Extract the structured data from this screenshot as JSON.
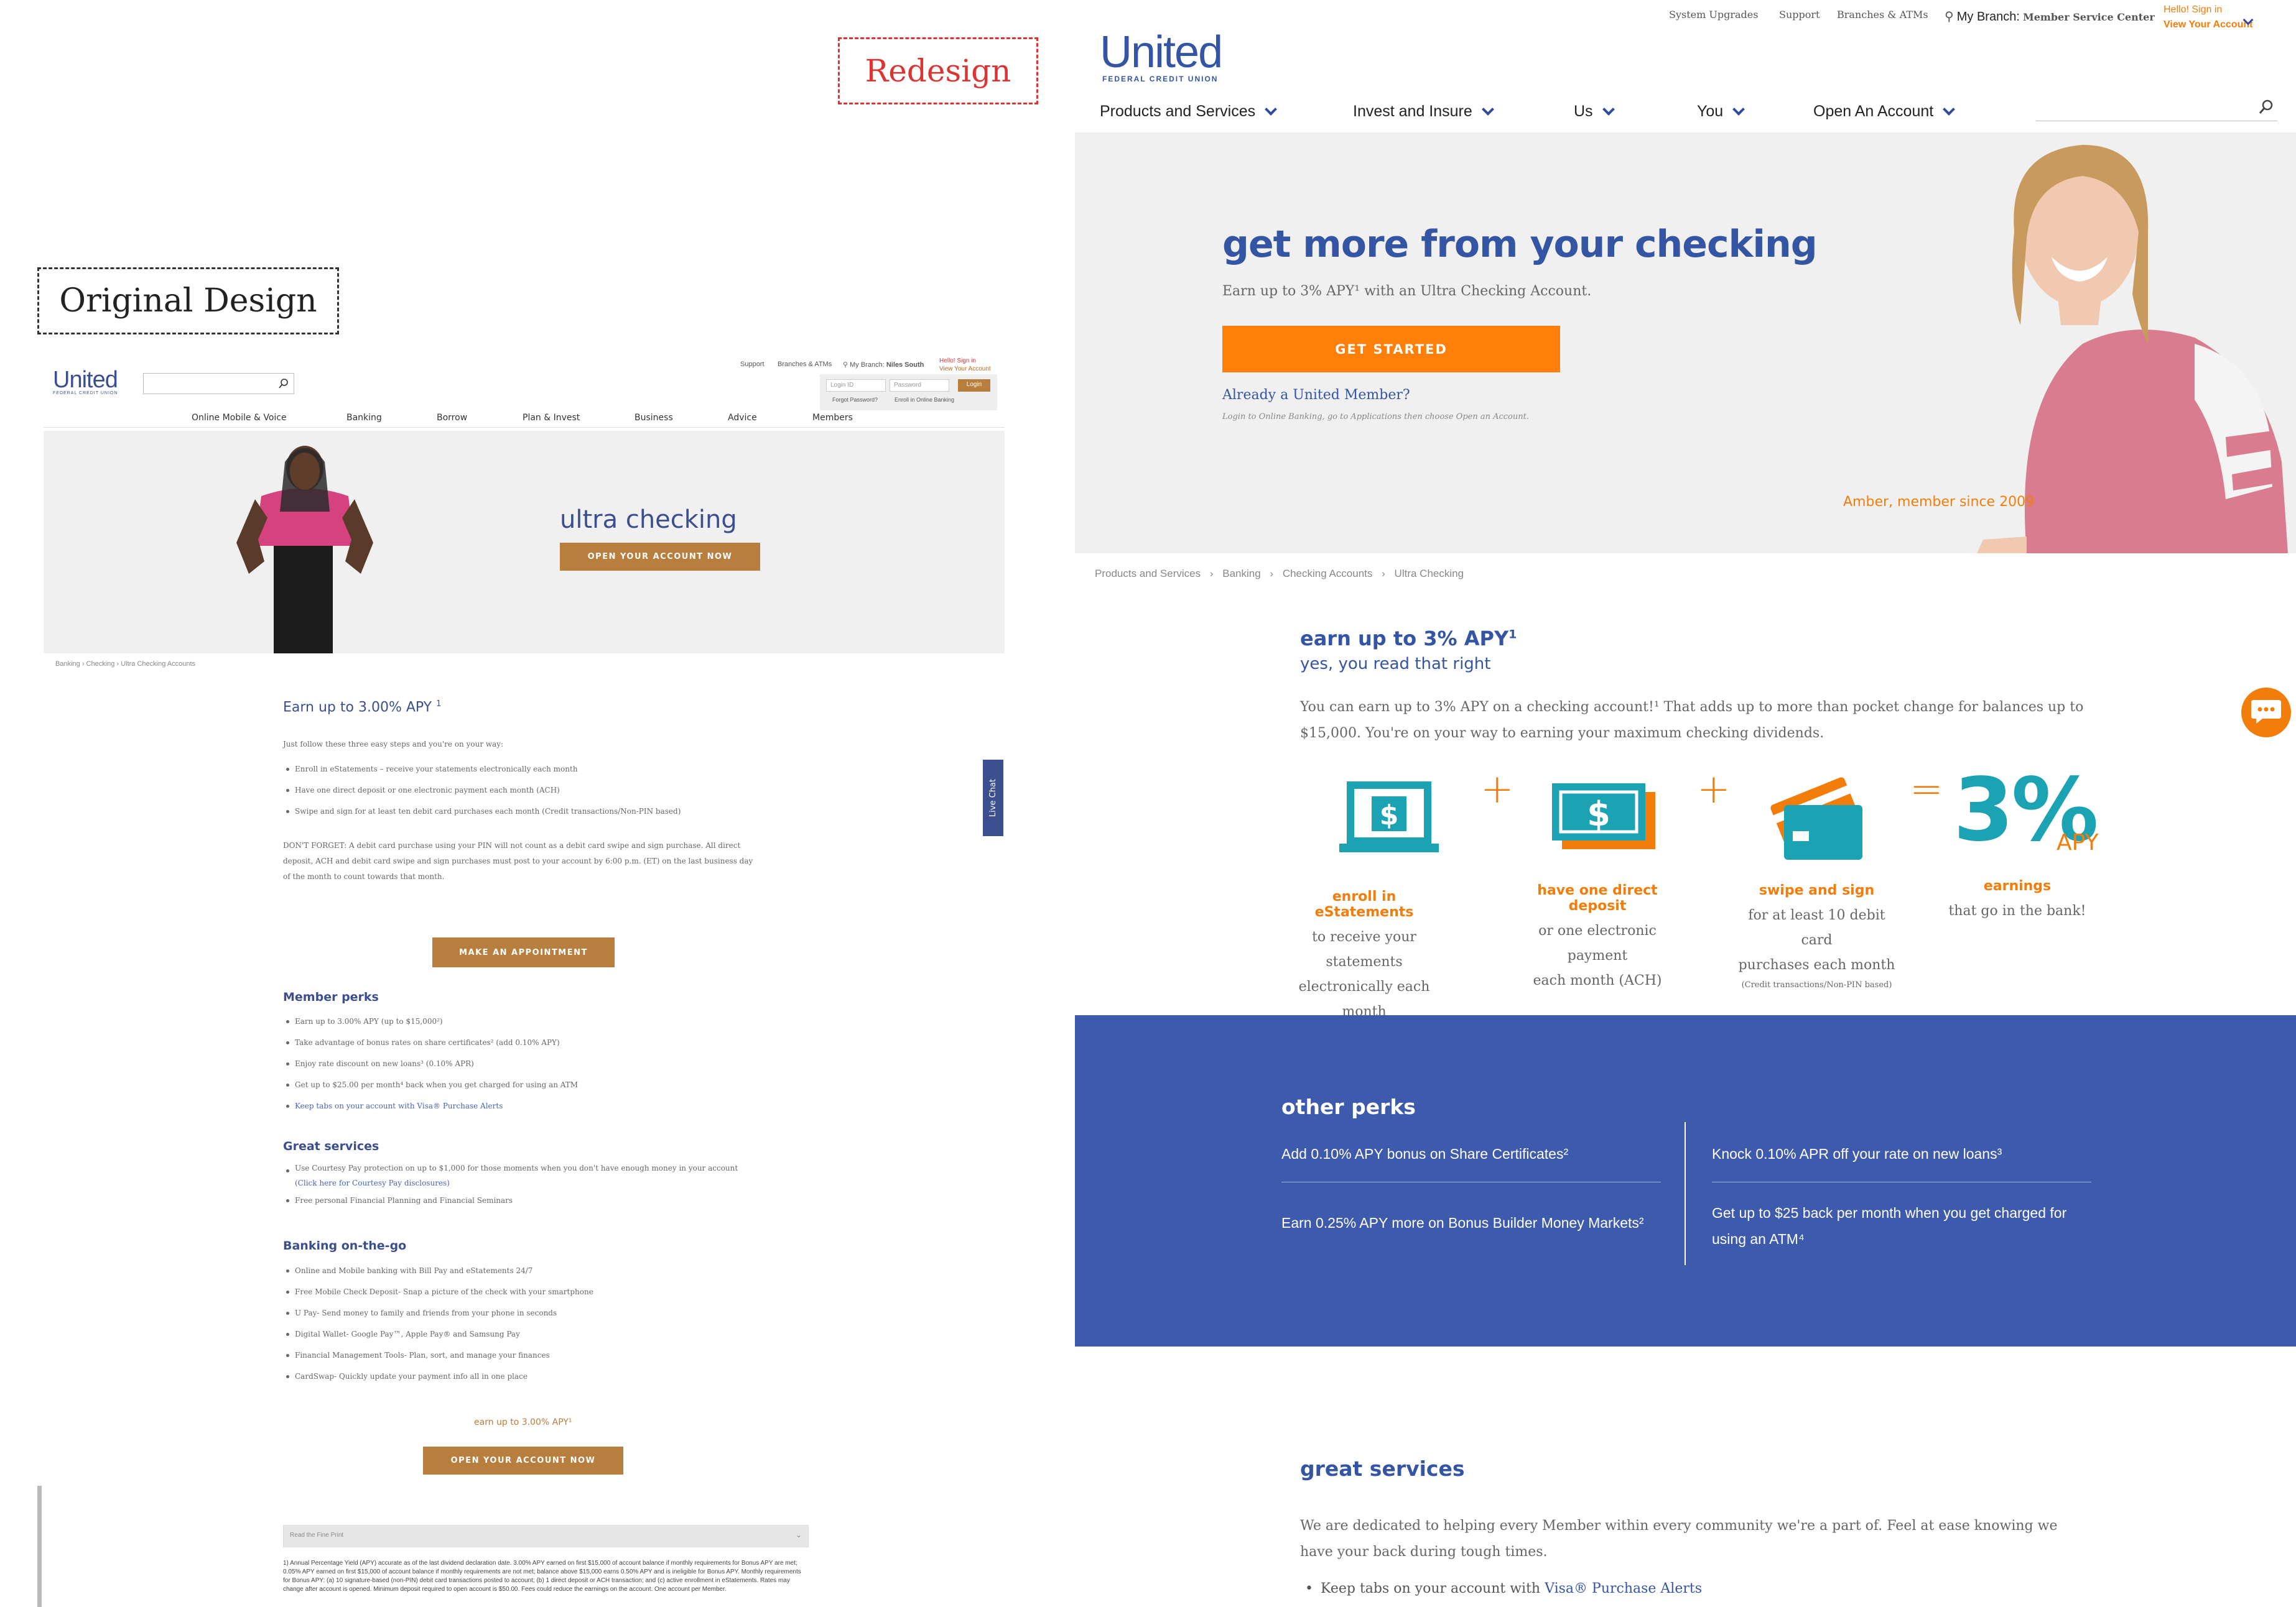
{
  "labels": {
    "redesign": "Redesign",
    "original": "Original Design"
  },
  "original": {
    "logo": {
      "name": "United",
      "sub": "FEDERAL CREDIT UNION"
    },
    "top_links": [
      "Support",
      "Branches & ATMs"
    ],
    "branch_label": "My Branch:",
    "branch_name": "Niles South",
    "hello": "Hello! Sign in",
    "view_account": "View Your Account",
    "login_placeholder": "Login ID",
    "password_placeholder": "Password",
    "login_btn": "Login",
    "forgot": "Forgot Password?",
    "enroll": "Enroll in Online Banking",
    "nav": [
      "Online Mobile & Voice",
      "Banking",
      "Borrow",
      "Plan & Invest",
      "Business",
      "Advice",
      "Members"
    ],
    "hero_title": "ultra checking",
    "hero_btn": "OPEN YOUR ACCOUNT NOW",
    "breadcrumb": [
      "Banking",
      "Checking",
      "Ultra Checking Accounts"
    ],
    "earn_title": "Earn up to 3.00% APY",
    "earn_sup": "1",
    "intro": "Just follow these three easy steps and you're on your way:",
    "steps": [
      "Enroll in eStatements – receive your statements electronically each month",
      "Have one direct deposit or one electronic payment each month (ACH)",
      "Swipe and sign for at least ten debit card purchases each month (Credit transactions/Non-PIN based)"
    ],
    "dont_forget": "DON'T FORGET: A debit card purchase using your PIN will not count as a debit card swipe and sign purchase. All direct deposit, ACH and debit card swipe and sign purchases must post to your account by 6:00 p.m. (ET) on the last business day of the month to count towards that month.",
    "appt_btn": "MAKE AN APPOINTMENT",
    "live_chat": "Live Chat",
    "perks_title": "Member perks",
    "perks": [
      "Earn up to 3.00% APY (up to $15,000²)",
      "Take advantage of bonus rates on share certificates² (add 0.10% APY)",
      "Enjoy rate discount on new loans³ (0.10% APR)",
      "Get up to $25.00 per month⁴ back when you get charged for using an ATM",
      "Keep tabs on your account with Visa® Purchase Alerts"
    ],
    "services_title": "Great services",
    "services": [
      "Use Courtesy Pay protection on up to $1,000 for those moments when you don't have enough money in your account",
      "(Click here for Courtesy Pay disclosures)",
      "Free personal Financial Planning and Financial Seminars"
    ],
    "go_title": "Banking on-the-go",
    "go": [
      "Online and Mobile banking with Bill Pay and eStatements 24/7",
      "Free Mobile Check Deposit- Snap a picture of the check with your smartphone",
      "U Pay- Send money to family and friends from your phone in seconds",
      "Digital Wallet- Google Pay™, Apple Pay® and Samsung Pay",
      "Financial Management Tools- Plan, sort, and manage your finances",
      "CardSwap- Quickly update your payment info all in one place"
    ],
    "bottom_earn": "earn up to 3.00% APY¹",
    "bottom_btn": "OPEN YOUR ACCOUNT NOW",
    "fine_print": "Read the Fine Print",
    "fine_text": "1) Annual Percentage Yield (APY) accurate as of the last dividend declaration date. 3.00% APY earned on first $15,000 of account balance if monthly requirements for Bonus APY are met; 0.05% APY earned on first $15,000 of account balance if monthly requirements are not met; balance above $15,000 earns 0.50% APY and is ineligible for Bonus APY. Monthly requirements for Bonus APY: (a) 10 signature-based (non-PIN) debit card transactions posted to account; (b) 1 direct deposit or ACH transaction; and (c) active enrollment in eStatements. Rates may change after account is opened. Minimum deposit required to open account is $50.00. Fees could reduce the earnings on the account. One account per Member."
  },
  "redesign": {
    "top_links": [
      "System Upgrades",
      "Support",
      "Branches & ATMs"
    ],
    "branch_label": "My Branch:",
    "branch_name": "Member Service Center",
    "hello": "Hello! Sign in",
    "view_account": "View Your Account",
    "logo": {
      "name": "United",
      "sub": "FEDERAL CREDIT UNION"
    },
    "nav": [
      "Products and Services",
      "Invest and Insure",
      "Us",
      "You",
      "Open An Account"
    ],
    "hero_title": "get more from your checking",
    "hero_sub": "Earn up to 3% APY¹ with an Ultra Checking Account.",
    "cta": "GET STARTED",
    "already": "Already a United Member?",
    "already_note": "Login to Online Banking, go to Applications then choose Open an Account.",
    "caption": "Amber, member since 2009",
    "breadcrumb": [
      "Products and Services",
      "Banking",
      "Checking Accounts",
      "Ultra Checking"
    ],
    "earn_title": "earn up to 3% APY",
    "earn_sup": "1",
    "earn_sub": "yes, you read that right",
    "earn_body": "You can earn up to 3% APY on a checking account!¹ That adds up to more than pocket change for balances up to $15,000. You're on your way to earning your maximum checking dividends.",
    "steps": [
      {
        "title": "enroll in eStatements",
        "desc": [
          "to receive your statements",
          "electronically each month"
        ],
        "icon": "laptop-dollar-icon"
      },
      {
        "title": "have one direct deposit",
        "desc": [
          "or one electronic payment",
          "each month (ACH)"
        ],
        "icon": "cash-bill-icon"
      },
      {
        "title": "swipe and sign",
        "desc": [
          "for at least 10 debit card",
          "purchases each month"
        ],
        "note": "(Credit transactions/Non-PIN based)",
        "icon": "debit-card-icon"
      }
    ],
    "plus": "+",
    "equals": "=",
    "result_big": "3%",
    "result_apy": "APY",
    "result_title": "earnings",
    "result_desc": "that go in the bank!",
    "perks_title": "other perks",
    "perks_left": [
      "Add 0.10% APY bonus on Share Certificates²",
      "Earn 0.25% APY more on Bonus Builder Money Markets²"
    ],
    "perks_right": [
      "Knock 0.10% APR off your rate on new loans³",
      "Get up to $25 back per month when you get charged for using an ATM⁴"
    ],
    "services_title": "great services",
    "services_body": "We are dedicated to helping every Member within every community we're a part of. Feel at ease knowing we have your back during tough times.",
    "services_item_prefix": "Keep tabs on your account with ",
    "services_item_link": "Visa® Purchase Alerts",
    "colors": {
      "brand_blue": "#3355a3",
      "orange": "#f37d0a",
      "teal": "#1ba3b3",
      "perk_bg": "#3d5aad"
    }
  }
}
